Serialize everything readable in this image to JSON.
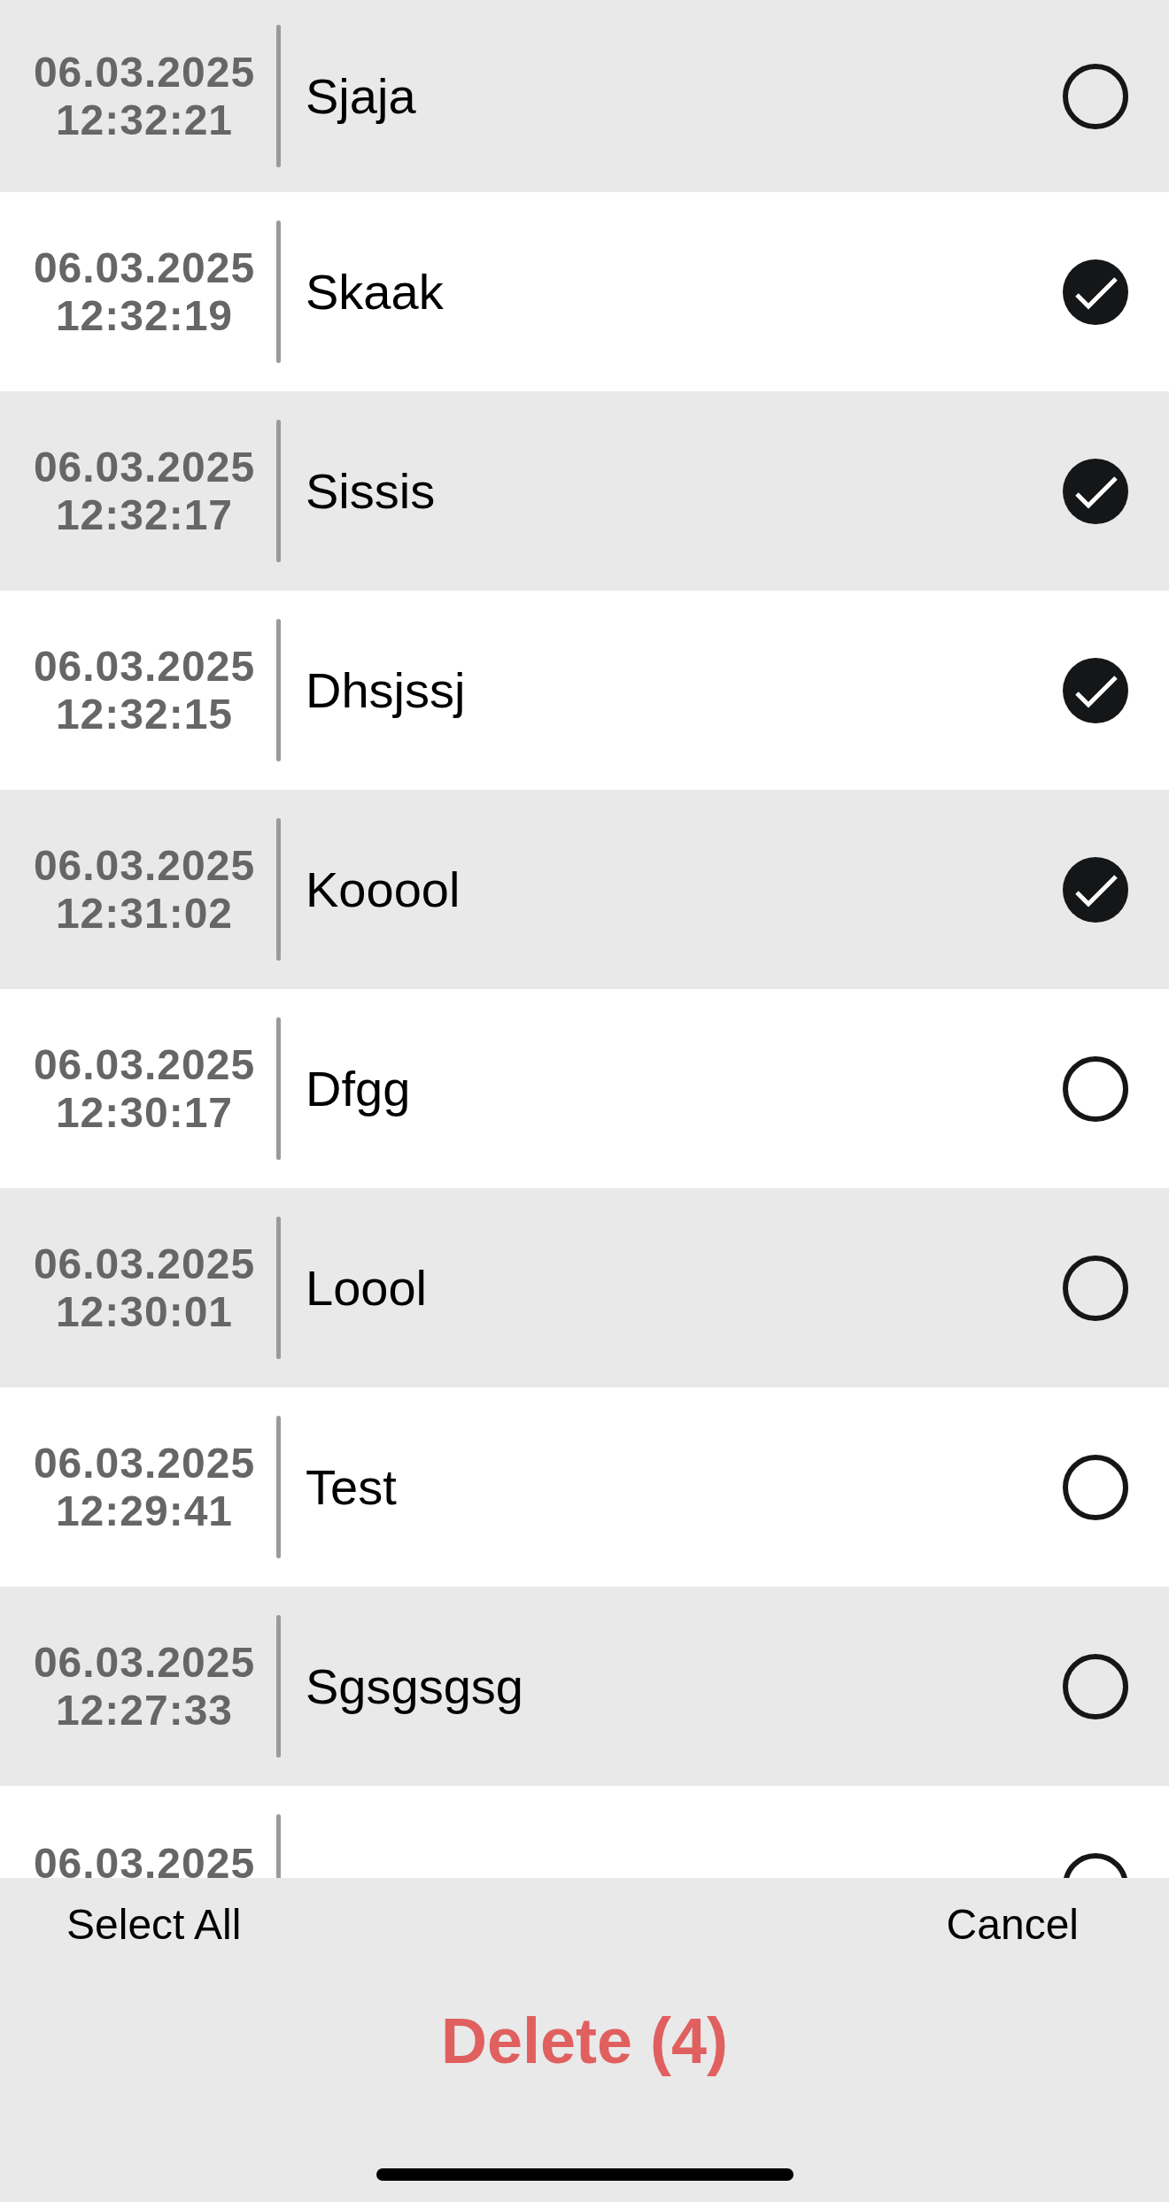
{
  "entries": [
    {
      "date": "06.03.2025",
      "time": "12:32:21",
      "title": "Sjaja",
      "selected": false
    },
    {
      "date": "06.03.2025",
      "time": "12:32:19",
      "title": "Skaak",
      "selected": true
    },
    {
      "date": "06.03.2025",
      "time": "12:32:17",
      "title": "Sissis",
      "selected": true
    },
    {
      "date": "06.03.2025",
      "time": "12:32:15",
      "title": "Dhsjssj",
      "selected": true
    },
    {
      "date": "06.03.2025",
      "time": "12:31:02",
      "title": "Kooool",
      "selected": true
    },
    {
      "date": "06.03.2025",
      "time": "12:30:17",
      "title": "Dfgg",
      "selected": false
    },
    {
      "date": "06.03.2025",
      "time": "12:30:01",
      "title": "Loool",
      "selected": false
    },
    {
      "date": "06.03.2025",
      "time": "12:29:41",
      "title": "Test",
      "selected": false
    },
    {
      "date": "06.03.2025",
      "time": "12:27:33",
      "title": "Sgsgsgsg",
      "selected": false
    },
    {
      "date": "06.03.2025",
      "selected": false
    }
  ],
  "toolbar": {
    "select_all": "Select All",
    "cancel": "Cancel",
    "delete_button": "Delete (4)"
  }
}
